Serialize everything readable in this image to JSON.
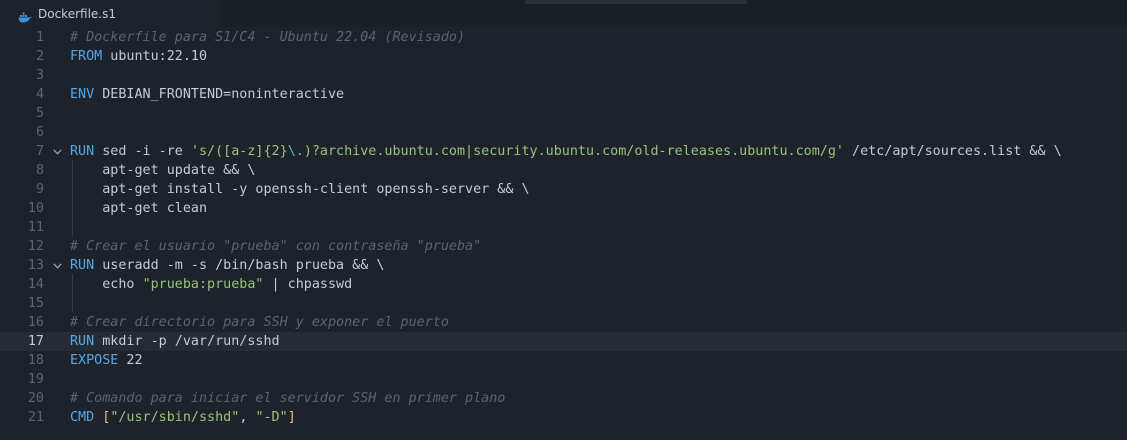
{
  "tab": {
    "filename": "Dockerfile.s1"
  },
  "active_line": 17,
  "lines": [
    {
      "n": "1",
      "fold": false,
      "segs": [
        [
          "cm",
          "# Dockerfile para S1/C4 - Ubuntu 22.04 (Revisado)"
        ]
      ]
    },
    {
      "n": "2",
      "fold": false,
      "segs": [
        [
          "kw",
          "FROM"
        ],
        [
          "op",
          " ubuntu:22.10"
        ]
      ]
    },
    {
      "n": "3",
      "fold": false,
      "segs": []
    },
    {
      "n": "4",
      "fold": false,
      "segs": [
        [
          "kw",
          "ENV"
        ],
        [
          "op",
          " DEBIAN_FRONTEND=noninteractive"
        ]
      ]
    },
    {
      "n": "5",
      "fold": false,
      "segs": []
    },
    {
      "n": "6",
      "fold": false,
      "segs": []
    },
    {
      "n": "7",
      "fold": true,
      "segs": [
        [
          "kw",
          "RUN"
        ],
        [
          "op",
          " sed -i -re "
        ],
        [
          "st",
          "'s/([a-z]{2}"
        ],
        [
          "st2",
          "\\."
        ],
        [
          "st",
          ")?archive.ubuntu.com|security.ubuntu.com/old-releases.ubuntu.com/g'"
        ],
        [
          "op",
          " /etc/apt/sources.list && \\"
        ]
      ]
    },
    {
      "n": "8",
      "fold": false,
      "segs": [
        [
          "op",
          "    apt-get update && \\"
        ]
      ]
    },
    {
      "n": "9",
      "fold": false,
      "segs": [
        [
          "op",
          "    apt-get install -y openssh-client openssh-server && \\"
        ]
      ]
    },
    {
      "n": "10",
      "fold": false,
      "segs": [
        [
          "op",
          "    apt-get clean"
        ]
      ]
    },
    {
      "n": "11",
      "fold": false,
      "segs": []
    },
    {
      "n": "12",
      "fold": false,
      "segs": [
        [
          "cm",
          "# Crear el usuario \"prueba\" con contraseña \"prueba\""
        ]
      ]
    },
    {
      "n": "13",
      "fold": true,
      "segs": [
        [
          "kw",
          "RUN"
        ],
        [
          "op",
          " useradd -m -s /bin/bash prueba && \\"
        ]
      ]
    },
    {
      "n": "14",
      "fold": false,
      "segs": [
        [
          "op",
          "    echo "
        ],
        [
          "st",
          "\"prueba:prueba\""
        ],
        [
          "op",
          " | chpasswd"
        ]
      ]
    },
    {
      "n": "15",
      "fold": false,
      "segs": []
    },
    {
      "n": "16",
      "fold": false,
      "segs": [
        [
          "cm",
          "# Crear directorio para SSH y exponer el puerto"
        ]
      ]
    },
    {
      "n": "17",
      "fold": false,
      "segs": [
        [
          "kw",
          "RUN"
        ],
        [
          "op",
          " mkdir -p /var/run/sshd"
        ]
      ]
    },
    {
      "n": "18",
      "fold": false,
      "segs": [
        [
          "kw",
          "EXPOSE"
        ],
        [
          "op",
          " 22"
        ]
      ]
    },
    {
      "n": "19",
      "fold": false,
      "segs": []
    },
    {
      "n": "20",
      "fold": false,
      "segs": [
        [
          "cm",
          "# Comando para iniciar el servidor SSH en primer plano"
        ]
      ]
    },
    {
      "n": "21",
      "fold": false,
      "segs": [
        [
          "kw",
          "CMD"
        ],
        [
          "op",
          " "
        ],
        [
          "br",
          "["
        ],
        [
          "st",
          "\"/usr/sbin/sshd\""
        ],
        [
          "op",
          ", "
        ],
        [
          "st",
          "\"-D\""
        ],
        [
          "br",
          "]"
        ]
      ]
    }
  ]
}
